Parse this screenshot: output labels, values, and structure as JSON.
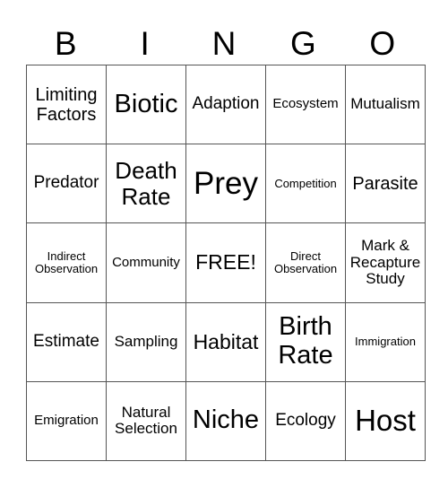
{
  "header": [
    "B",
    "I",
    "N",
    "G",
    "O"
  ],
  "rows": [
    [
      "Limiting Factors",
      "Biotic",
      "Adaption",
      "Ecosystem",
      "Mutualism"
    ],
    [
      "Predator",
      "Death Rate",
      "Prey",
      "Competition",
      "Parasite"
    ],
    [
      "Indirect Observation",
      "Community",
      "FREE!",
      "Direct Observation",
      "Mark & Recapture Study"
    ],
    [
      "Estimate",
      "Sampling",
      "Habitat",
      "Birth Rate",
      "Immigration"
    ],
    [
      "Emigration",
      "Natural Selection",
      "Niche",
      "Ecology",
      "Host"
    ]
  ]
}
